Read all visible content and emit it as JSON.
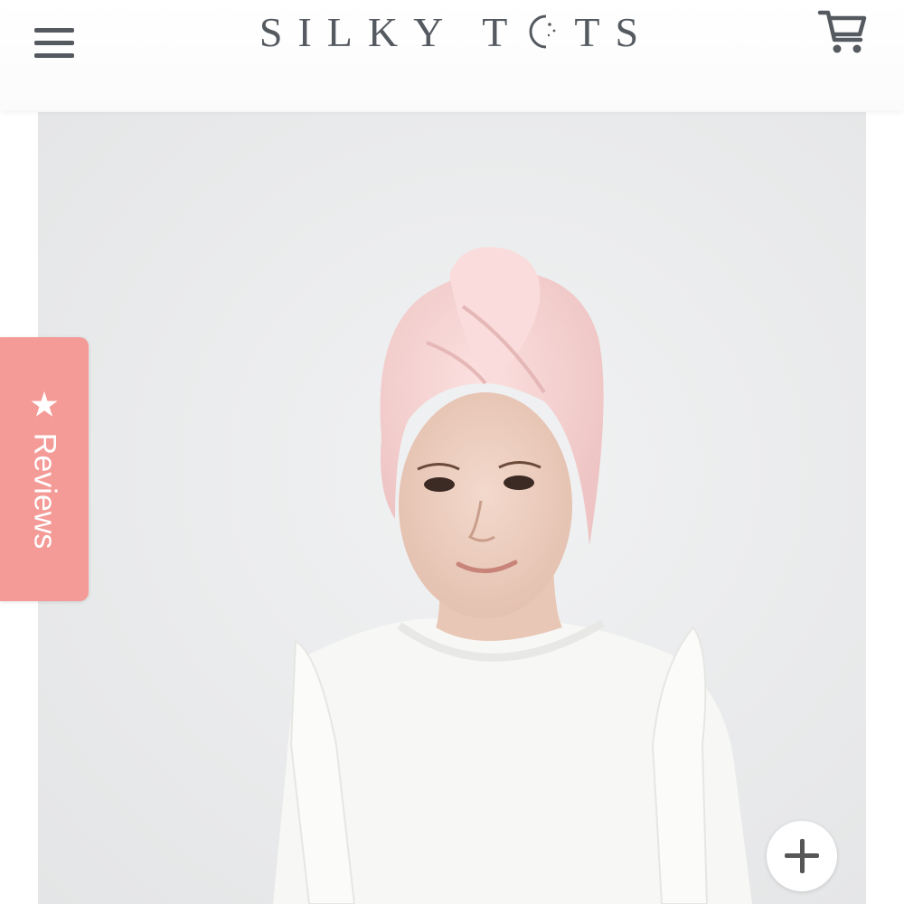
{
  "header": {
    "brand": "SILKY TOTS",
    "brand_part1": "SILKY T",
    "brand_part2": "TS",
    "menu_icon": "hamburger-menu-icon",
    "cart_icon": "shopping-cart-icon",
    "text_color": "#545a60"
  },
  "product": {
    "image": "girl-wearing-pink-hair-towel-turban",
    "towel_color": "#f6d3d2"
  },
  "reviews_tab": {
    "label": "Reviews",
    "icon": "star-icon",
    "background": "#f49b98"
  },
  "zoom_button": {
    "icon": "plus-icon"
  }
}
